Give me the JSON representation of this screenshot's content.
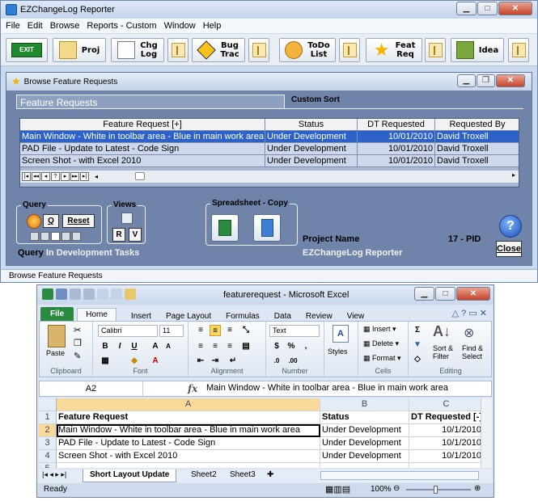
{
  "app": {
    "title": "EZChangeLog Reporter",
    "menu": [
      "File",
      "Edit",
      "Browse",
      "Reports - Custom",
      "Window",
      "Help"
    ],
    "toolbar": {
      "exit": "EXIT",
      "proj": "Proj",
      "chglog": "Chg\nLog",
      "bugtrac": "Bug\nTrac",
      "todo": "ToDo\nList",
      "featreq": "Feat\nReq",
      "idea": "Idea"
    },
    "status": "Browse Feature Requests"
  },
  "child": {
    "title": "Browse Feature Requests",
    "tab_active": "Feature Requests",
    "tab_other": "Custom Sort",
    "grid": {
      "columns": [
        "Feature Request [+]",
        "Status",
        "DT Requested",
        "Requested By"
      ],
      "rows": [
        {
          "request": "Main Window - White in toolbar area - Blue in main work area",
          "status": "Under Development",
          "date": "10/01/2010",
          "by": "David Troxell"
        },
        {
          "request": "PAD File - Update to Latest - Code Sign",
          "status": "Under Development",
          "date": "10/01/2010",
          "by": "David Troxell"
        },
        {
          "request": "Screen Shot - with Excel 2010",
          "status": "Under Development",
          "date": "10/01/2010",
          "by": "David Troxell"
        }
      ]
    },
    "query": {
      "label": "Query",
      "q_button": "Q",
      "reset_button": "Reset",
      "caption_bold": "Query",
      "caption_text": "In Development Tasks"
    },
    "views": {
      "label": "Views",
      "r_button": "R",
      "v_button": "V"
    },
    "spreadsheet": {
      "label": "Spreadsheet - Copy"
    },
    "project": {
      "name_label": "Project Name",
      "pid": "17 - PID",
      "app_name": "EZChangeLog Reporter"
    },
    "close_button": "Close",
    "help_button": "?"
  },
  "excel": {
    "title": "featurerequest - Microsoft Excel",
    "tabs": [
      "File",
      "Home",
      "Insert",
      "Page Layout",
      "Formulas",
      "Data",
      "Review",
      "View"
    ],
    "ribbon": {
      "clipboard": "Clipboard",
      "paste": "Paste",
      "font_group": "Font",
      "font_name": "Calibri",
      "font_size": "11",
      "alignment": "Alignment",
      "number_group": "Number",
      "number_format": "Text",
      "styles": "Styles",
      "cells_group": "Cells",
      "insert": "Insert",
      "delete": "Delete",
      "format": "Format",
      "editing": "Editing",
      "sort": "Sort &\nFilter",
      "find": "Find &\nSelect"
    },
    "namebox": "A2",
    "formula": "Main Window - White in toolbar area - Blue in main work area",
    "columns": [
      "A",
      "B",
      "C"
    ],
    "rows": [
      {
        "n": "1",
        "a": "Feature Request",
        "b": "Status",
        "c": "DT Requested [-]"
      },
      {
        "n": "2",
        "a": "Main Window - White in toolbar area - Blue in main work area",
        "b": "Under Development",
        "c": "10/1/2010"
      },
      {
        "n": "3",
        "a": "PAD File - Update to Latest - Code Sign",
        "b": "Under Development",
        "c": "10/1/2010"
      },
      {
        "n": "4",
        "a": "Screen Shot - with Excel 2010",
        "b": "Under Development",
        "c": "10/1/2010"
      },
      {
        "n": "5",
        "a": "",
        "b": "",
        "c": ""
      }
    ],
    "sheet_tabs": [
      "Short Layout Update",
      "Sheet2",
      "Sheet3"
    ],
    "status": "Ready",
    "zoom": "100%"
  }
}
